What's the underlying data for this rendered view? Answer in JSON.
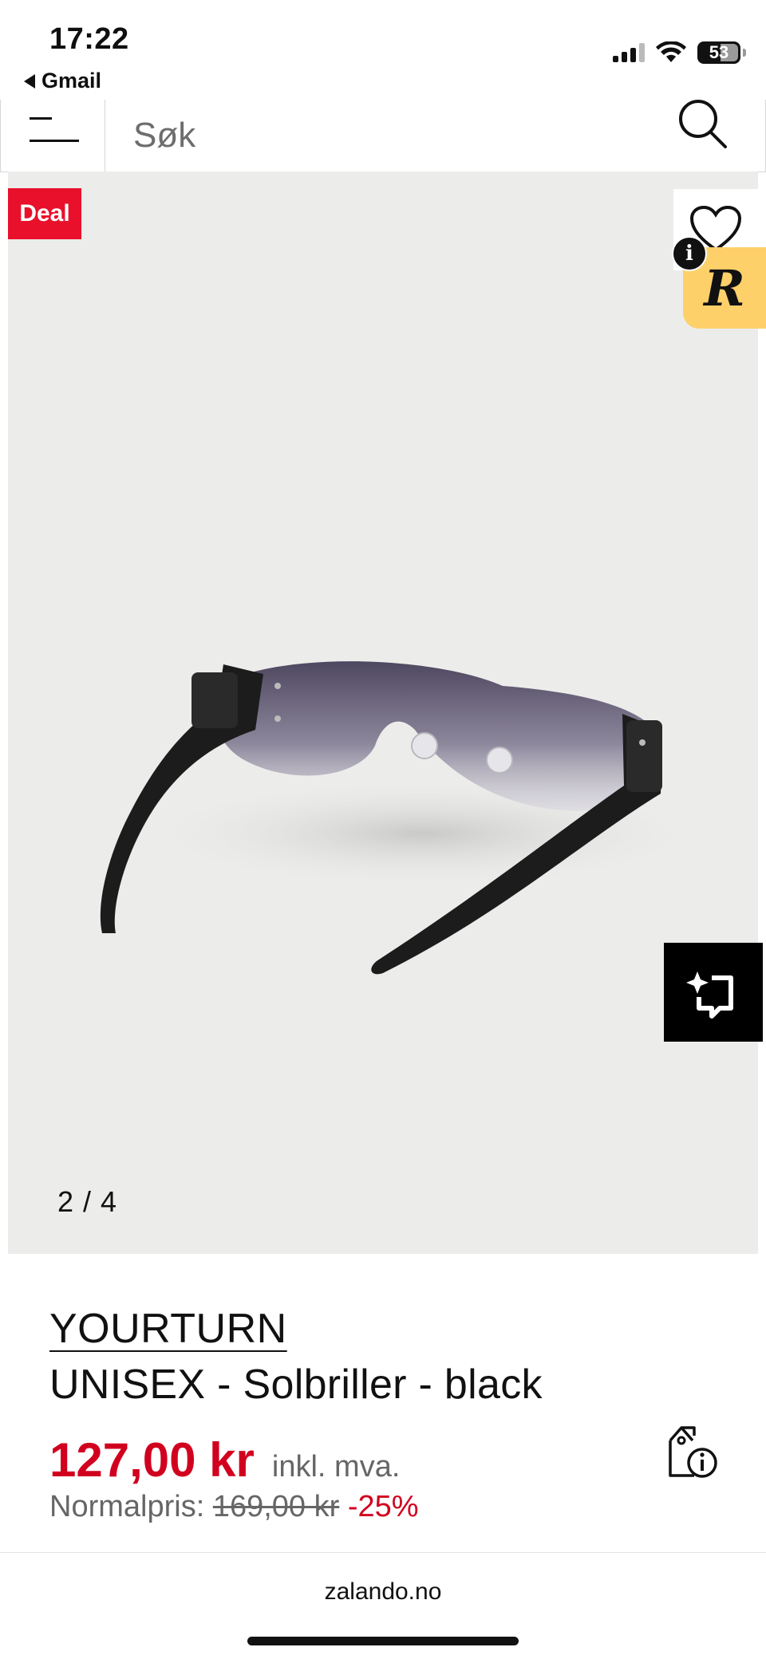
{
  "status_bar": {
    "time": "17:22",
    "back_app": "Gmail",
    "battery": "53",
    "icons": [
      "cellular-signal-icon",
      "wifi-icon",
      "battery-icon"
    ]
  },
  "header": {
    "search_placeholder": "Søk",
    "icons": [
      "hamburger-menu-icon",
      "search-icon"
    ]
  },
  "gallery": {
    "deal_badge": "Deal",
    "counter": "2 / 4",
    "image_alt": "sunglasses-product-photo",
    "icons": [
      "heart-icon",
      "info-icon",
      "r-badge-icon",
      "ai-sparkle-icon"
    ]
  },
  "product": {
    "brand": "YOURTURN",
    "name": "UNISEX - Solbriller - black",
    "price": "127,00 kr",
    "vat_note": "inkl. mva.",
    "normal_label": "Normalpris:",
    "old_price": "169,00 kr",
    "discount": "-25%",
    "price_info_icon": "price-tag-info-icon"
  },
  "browser": {
    "url": "zalando.no"
  },
  "colors": {
    "sale_red": "#d1001f",
    "deal_red": "#e8102a",
    "badge_yellow": "#fdd06a"
  }
}
